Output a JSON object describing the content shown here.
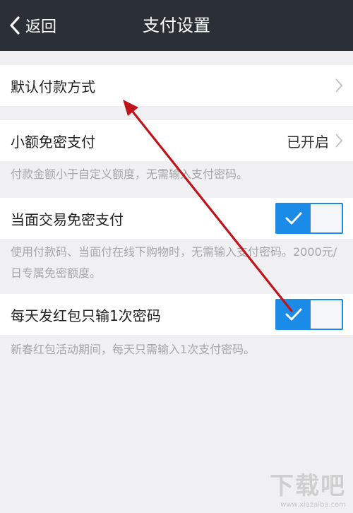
{
  "nav": {
    "back_label": "返回",
    "title": "支付设置"
  },
  "rows": {
    "default_payment": {
      "label": "默认付款方式"
    },
    "small_amount": {
      "label": "小额免密支付",
      "value": "已开启",
      "note": "付款金额小于自定义额度，无需输入支付密码。"
    },
    "face_to_face": {
      "label": "当面交易免密支付",
      "enabled": true,
      "note": "使用付款码、当面付在线下购物时，无需输入支付密码。2000元/日专属免密额度。"
    },
    "red_packet": {
      "label": "每天发红包只输1次密码",
      "enabled": true,
      "note": "新春红包活动期间，每天只需输入1次支付密码。"
    }
  },
  "colors": {
    "nav_bg": "#2b2f36",
    "toggle_on": "#1b8be8",
    "annotation_arrow": "#c0141b"
  },
  "watermark": {
    "main": "下载吧",
    "sub": "www.xiazaiba.com"
  }
}
